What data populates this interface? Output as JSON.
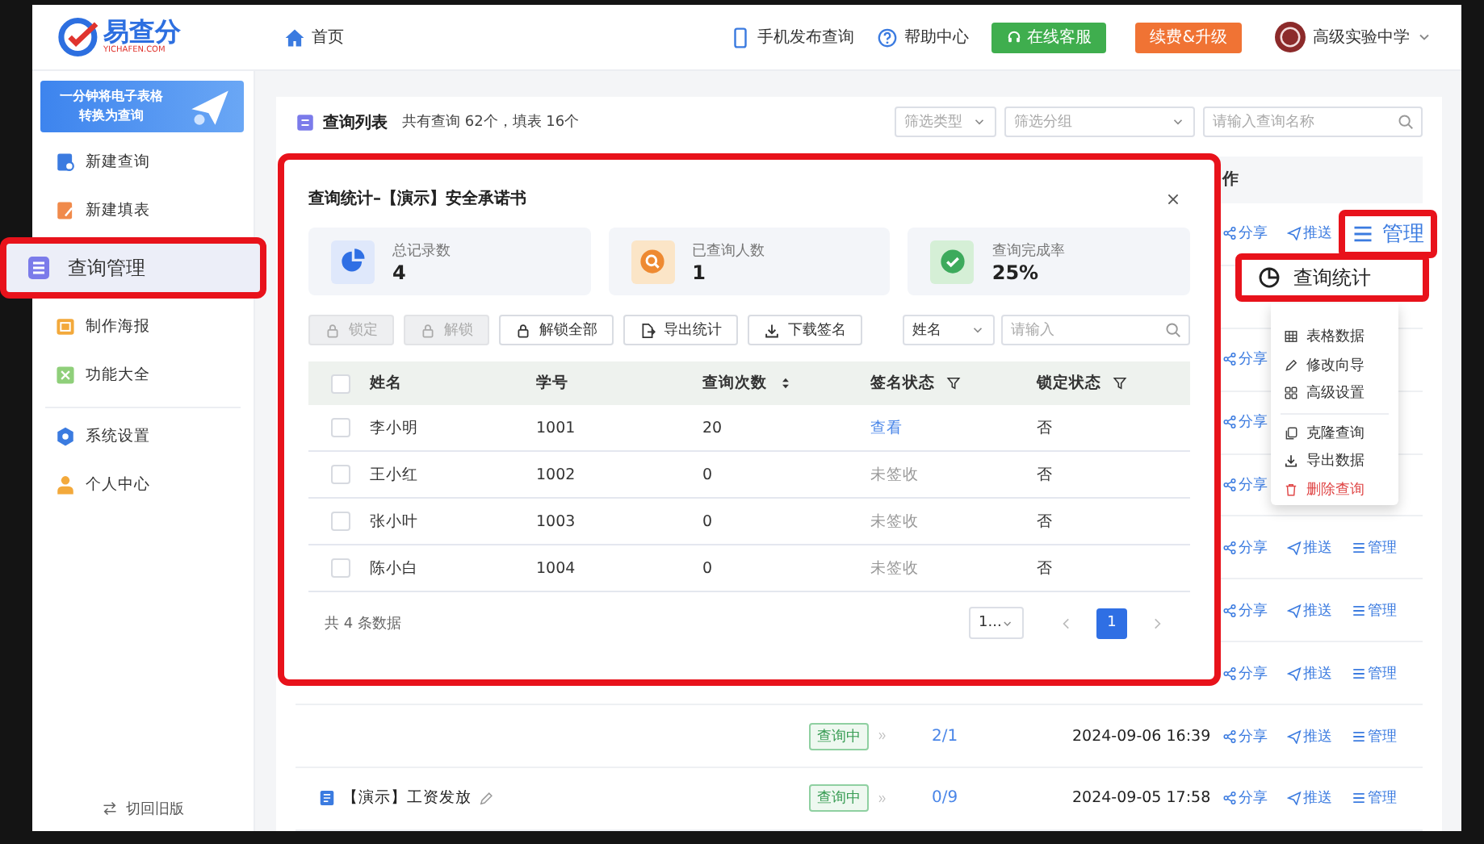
{
  "logo": {
    "name": "易查分",
    "domain": "YICHAFEN.COM"
  },
  "topbar": {
    "home": "首页",
    "links": [
      "手机发布查询",
      "帮助中心"
    ],
    "buttons": [
      {
        "label": "在线客服",
        "kind": "support"
      },
      {
        "label": "续费&升级",
        "kind": "upgrade"
      }
    ],
    "school": "高级实验中学"
  },
  "sidebar": {
    "banner": [
      "一分钟将电子表格",
      "转换为查询"
    ],
    "groups": [
      [
        {
          "label": "新建查询",
          "selected": false
        },
        {
          "label": "新建填表",
          "selected": false
        },
        {
          "label": "查询管理",
          "selected": true
        },
        {
          "label": "制作海报",
          "selected": false
        },
        {
          "label": "功能大全",
          "selected": false
        }
      ],
      [
        {
          "label": "系统设置",
          "selected": false
        },
        {
          "label": "个人中心",
          "selected": false
        }
      ]
    ],
    "footer": "切回旧版"
  },
  "list": {
    "title": "查询列表",
    "summary": "共有查询 62个，填表 16个",
    "filters": [
      {
        "placeholder": "筛选类型"
      },
      {
        "placeholder": "筛选分组"
      }
    ],
    "search": {
      "placeholder": "请输入查询名称"
    },
    "column_5": "作",
    "rows": [
      {
        "actions": [
          {
            "label": "分享",
            "highlighted": false
          },
          {
            "label": "推送",
            "highlighted": false
          },
          {
            "label": "管理",
            "highlighted": true
          }
        ]
      },
      {},
      {
        "actions": [
          {
            "label": "分享",
            "highlighted": false
          }
        ]
      },
      {
        "actions": [
          {
            "label": "分享",
            "highlighted": false
          }
        ]
      },
      {
        "actions": [
          {
            "label": "分享",
            "highlighted": false
          }
        ]
      },
      {
        "actions": [
          {
            "label": "分享",
            "highlighted": false
          },
          {
            "label": "推送",
            "highlighted": false
          },
          {
            "label": "管理",
            "highlighted": false
          }
        ]
      },
      {
        "actions": [
          {
            "label": "分享",
            "highlighted": false
          },
          {
            "label": "推送",
            "highlighted": false
          },
          {
            "label": "管理",
            "highlighted": false
          }
        ]
      },
      {
        "actions": [
          {
            "label": "分享",
            "highlighted": false
          },
          {
            "label": "推送",
            "highlighted": false
          },
          {
            "label": "管理",
            "highlighted": false
          }
        ]
      },
      {
        "status": "查询中",
        "count": "2/1",
        "date": "2024-09-06 16:39",
        "actions": [
          {
            "label": "分享",
            "highlighted": false
          },
          {
            "label": "推送",
            "highlighted": false
          },
          {
            "label": "管理",
            "highlighted": false
          }
        ]
      },
      {
        "title": "【演示】工资发放",
        "status": "查询中",
        "count": "0/9",
        "date": "2024-09-05 17:58",
        "actions": [
          {
            "label": "分享",
            "highlighted": false
          },
          {
            "label": "推送",
            "highlighted": false
          },
          {
            "label": "管理",
            "highlighted": false
          }
        ]
      }
    ]
  },
  "modal": {
    "title": "查询统计–【演示】安全承诺书",
    "stats": [
      {
        "label": "总记录数",
        "value": "4",
        "kind": "records"
      },
      {
        "label": "已查询人数",
        "value": "1",
        "kind": "queried"
      },
      {
        "label": "查询完成率",
        "value": "25%",
        "kind": "rate"
      }
    ],
    "toolbar": [
      {
        "label": "锁定",
        "disabled": true
      },
      {
        "label": "解锁",
        "disabled": true
      },
      {
        "label": "解锁全部",
        "disabled": false
      },
      {
        "label": "导出统计",
        "disabled": false
      },
      {
        "label": "下载签名",
        "disabled": false
      }
    ],
    "field_select": "姓名",
    "search": {
      "placeholder": "请输入"
    },
    "all_checked": false,
    "columns": [
      {
        "label": "姓名",
        "kind": "plain"
      },
      {
        "label": "学号",
        "kind": "plain"
      },
      {
        "label": "查询次数",
        "kind": "sortable"
      },
      {
        "label": "签名状态",
        "kind": "filterable"
      },
      {
        "label": "锁定状态",
        "kind": "filterable"
      }
    ],
    "rows": [
      {
        "checked": false,
        "name": "李小明",
        "number": "1001",
        "count": "20",
        "signature": {
          "text": "查看",
          "kind": "link"
        },
        "locked": "否"
      },
      {
        "checked": false,
        "name": "王小红",
        "number": "1002",
        "count": "0",
        "signature": {
          "text": "未签收",
          "kind": "plain"
        },
        "locked": "否"
      },
      {
        "checked": false,
        "name": "张小叶",
        "number": "1003",
        "count": "0",
        "signature": {
          "text": "未签收",
          "kind": "plain"
        },
        "locked": "否"
      },
      {
        "checked": false,
        "name": "陈小白",
        "number": "1004",
        "count": "0",
        "signature": {
          "text": "未签收",
          "kind": "plain"
        },
        "locked": "否"
      }
    ],
    "total": "共 4 条数据",
    "page_size": "1...",
    "pages": [
      {
        "label": "1",
        "selected": true
      }
    ]
  },
  "manage_menu": {
    "highlighted_item": "查询统计",
    "groups": [
      [
        {
          "label": "表格数据",
          "kind": "normal"
        },
        {
          "label": "修改向导",
          "kind": "normal"
        },
        {
          "label": "高级设置",
          "kind": "normal"
        }
      ],
      [
        {
          "label": "克隆查询",
          "kind": "normal"
        },
        {
          "label": "导出数据",
          "kind": "normal"
        },
        {
          "label": "删除查询",
          "kind": "danger"
        }
      ]
    ]
  }
}
